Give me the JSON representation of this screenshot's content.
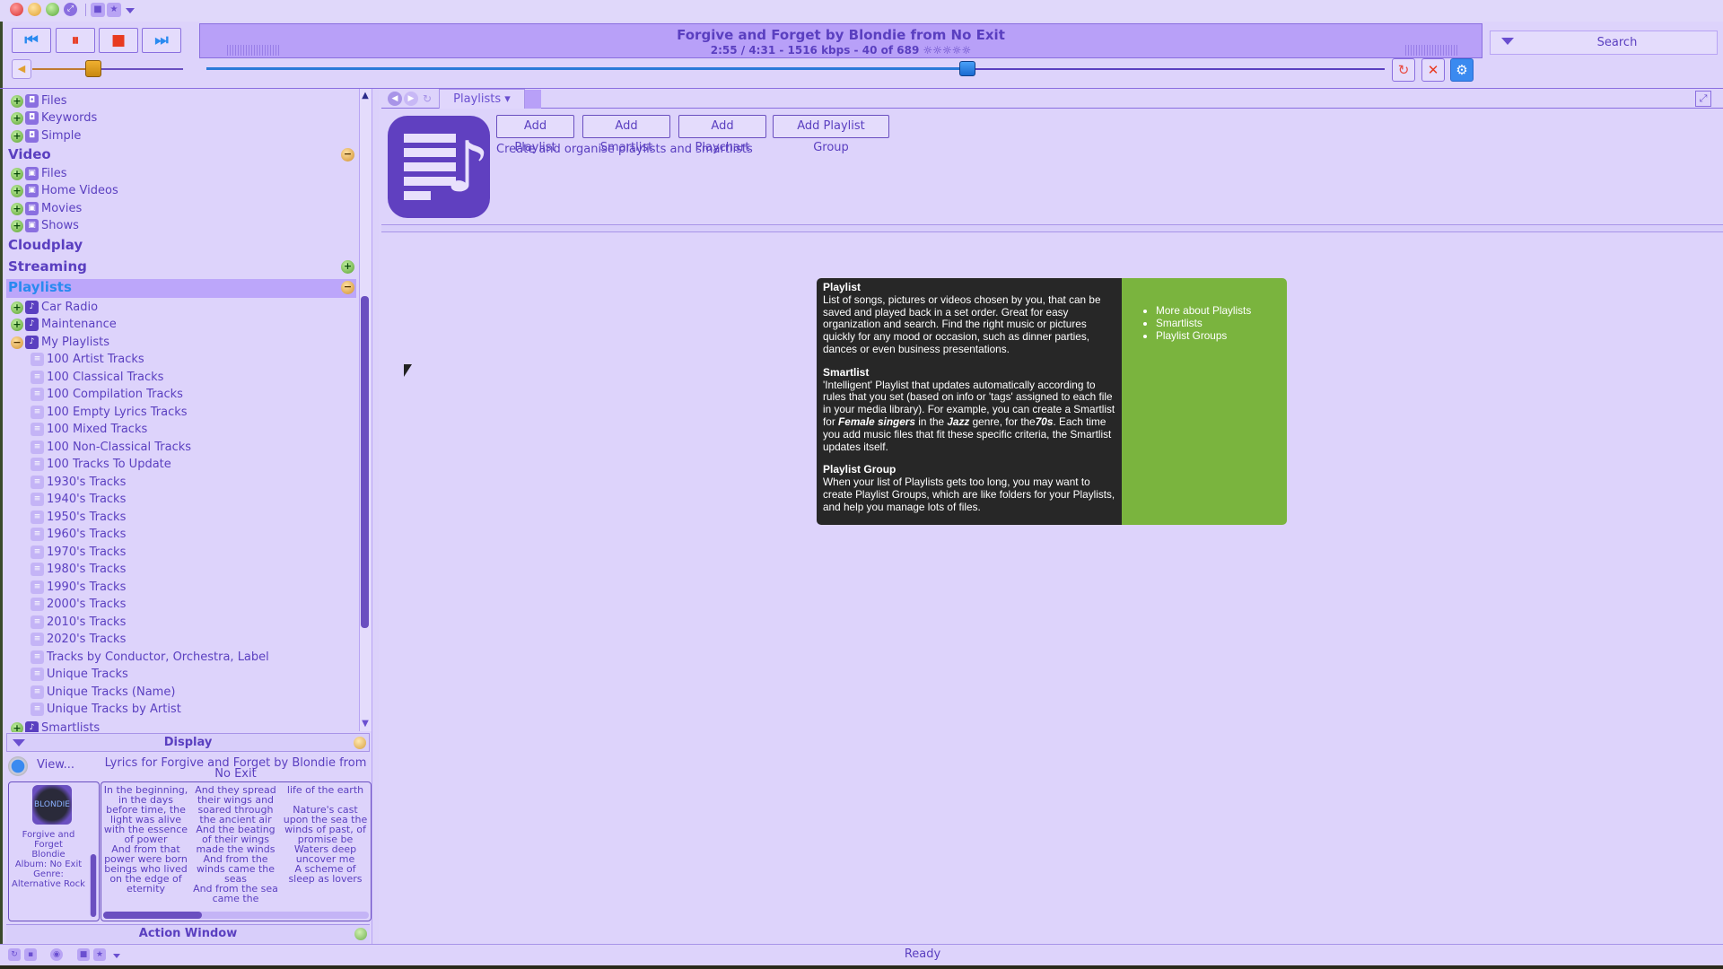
{
  "window": {
    "title_buttons": [
      "close",
      "minimize",
      "maximize",
      "fullscreen"
    ]
  },
  "transport": {
    "prev_icon": "⏮",
    "pause_icon": "⏸",
    "stop_icon": "■",
    "next_icon": "⏭",
    "volume_level": 0.38,
    "seek_position": 0.646
  },
  "now_playing": {
    "title": "Forgive and Forget by Blondie from No Exit",
    "info": "2:55 / 4:31 - 1516 kbps -  40 of 689 ☼☼☼☼☼",
    "elapsed": "2:55",
    "duration": "4:31",
    "bitrate": "1516 kbps",
    "track_index": "40 of 689",
    "rating_stars": 0
  },
  "search": {
    "label": "Search"
  },
  "sidebar": {
    "top_items": [
      {
        "label": "Files",
        "icon": "camera-icon"
      },
      {
        "label": "Keywords",
        "icon": "camera-icon"
      },
      {
        "label": "Simple",
        "icon": "camera-icon"
      }
    ],
    "video": {
      "heading": "Video",
      "items": [
        {
          "label": "Files"
        },
        {
          "label": "Home Videos"
        },
        {
          "label": "Movies"
        },
        {
          "label": "Shows"
        }
      ]
    },
    "cloudplay": "Cloudplay",
    "streaming": "Streaming",
    "playlists": {
      "heading": "Playlists",
      "groups": [
        {
          "label": "Car Radio",
          "expanded": false
        },
        {
          "label": "Maintenance",
          "expanded": false
        },
        {
          "label": "My Playlists",
          "expanded": true
        }
      ],
      "my_playlists": [
        "100 Artist Tracks",
        "100 Classical Tracks",
        "100 Compilation Tracks",
        "100 Empty Lyrics Tracks",
        "100 Mixed Tracks",
        "100 Non-Classical Tracks",
        "100 Tracks To Update",
        "1930's Tracks",
        "1940's Tracks",
        "1950's Tracks",
        "1960's Tracks",
        "1970's Tracks",
        "1980's Tracks",
        "1990's Tracks",
        "2000's Tracks",
        "2010's Tracks",
        "2020's Tracks",
        "Tracks by Conductor, Orchestra, Label",
        "Unique Tracks",
        "Unique Tracks (Name)",
        "Unique Tracks by Artist"
      ],
      "smartlists": "Smartlists"
    }
  },
  "display_panel": {
    "title": "Display",
    "view_label": "View...",
    "lyrics_title": "Lyrics for Forgive and Forget by Blondie from No Exit",
    "art_label": "BLONDIE",
    "track_info": "Forgive and Forget\nBlondie\nAlbum: No Exit\nGenre: Alternative Rock",
    "lyrics_columns": [
      "In the beginning, in the days before time, the light was alive with the essence of power\nAnd from that power were born beings who lived on the edge of eternity",
      "And they spread their wings and soared through the ancient air\nAnd the beating of their wings made the winds\nAnd from the winds came the seas\nAnd from the sea came the",
      "life of the earth\n\nNature's cast upon the sea the winds of past, of promise be\nWaters deep uncover me\nA scheme of sleep as lovers"
    ]
  },
  "action_window": {
    "title": "Action Window"
  },
  "main": {
    "tab_label": "Playlists ▾",
    "buttons": {
      "add_playlist": "Add Playlist",
      "add_smartlist": "Add Smartlist",
      "add_playchart": "Add Playchart",
      "add_playlist_group": "Add Playlist Group"
    },
    "subtitle": "Create and organise playlists and smartlists",
    "info": {
      "playlist_heading": "Playlist",
      "playlist_text": "List of songs, pictures or videos chosen by you, that can be saved and played back in a set order. Great for easy organization and search. Find the right music or pictures quickly for any mood or occasion, such as dinner parties, dances or even business presentations.",
      "smartlist_heading": "Smartlist",
      "smartlist_text_1": "'Intelligent' Playlist that updates automatically according to rules that you set (based on info or 'tags' assigned to each file in your media library). For example, you can create a Smartlist for ",
      "smartlist_em_1": "Female singers",
      "smartlist_text_2": " in the ",
      "smartlist_em_2": "Jazz",
      "smartlist_text_3": " genre, for the",
      "smartlist_em_3": "70s",
      "smartlist_text_4": ". Each time you add music files that fit these specific criteria, the Smartlist updates itself.",
      "group_heading": "Playlist Group",
      "group_text": "When your list of Playlists gets too long, you may want to create Playlist Groups, which are like folders for your Playlists, and help you manage lots of files.",
      "links": [
        "More about Playlists",
        "Smartlists",
        "Playlist Groups"
      ]
    }
  },
  "status": {
    "text": "Ready"
  },
  "colors": {
    "background": "#ddd3fb",
    "accent": "#5a3fc0",
    "selected": "#bca6fa",
    "info_dark": "#272727",
    "info_green": "#7ab43e",
    "selected_text": "#2a8af0"
  }
}
